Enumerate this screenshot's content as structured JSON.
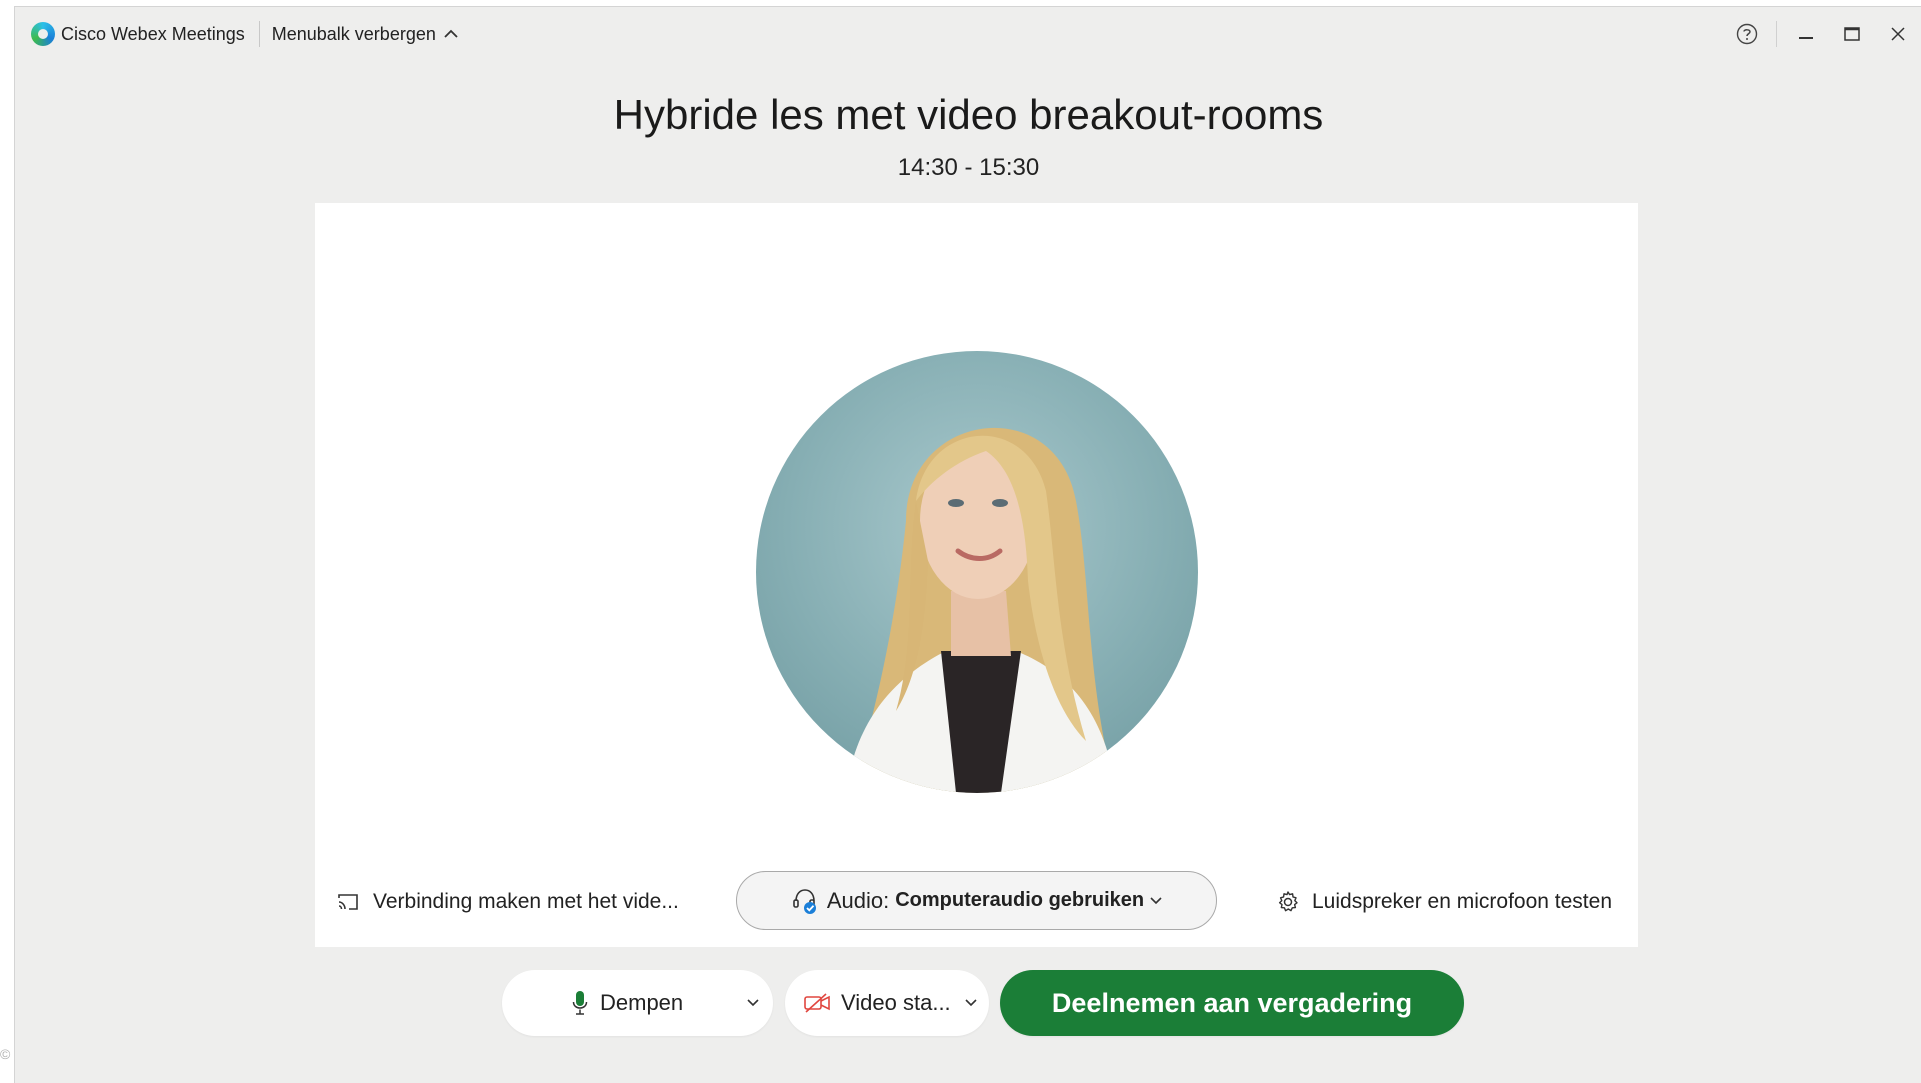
{
  "titlebar": {
    "app_name": "Cisco Webex Meetings",
    "menubar_toggle": "Menubalk verbergen"
  },
  "meeting": {
    "title": "Hybride les met video breakout-rooms",
    "time": "14:30 - 15:30"
  },
  "panel": {
    "connect_label": "Verbinding maken met het vide...",
    "audio_label": "Audio:",
    "audio_value": "Computeraudio gebruiken",
    "test_label": "Luidspreker en microfoon testen"
  },
  "controls": {
    "mute_label": "Dempen",
    "video_label": "Video sta...",
    "join_label": "Deelnemen aan vergadering"
  },
  "colors": {
    "join_button": "#1b7e37",
    "background": "#eeeeed",
    "panel": "#ffffff",
    "video_off_icon": "#e0463f",
    "mic_icon": "#1b7e37"
  },
  "icons": [
    "webex-logo-icon",
    "chevron-up-icon",
    "help-icon",
    "minimize-icon",
    "maximize-icon",
    "close-icon",
    "cast-icon",
    "headset-icon",
    "gear-icon",
    "microphone-icon",
    "video-off-icon",
    "chevron-down-icon"
  ]
}
